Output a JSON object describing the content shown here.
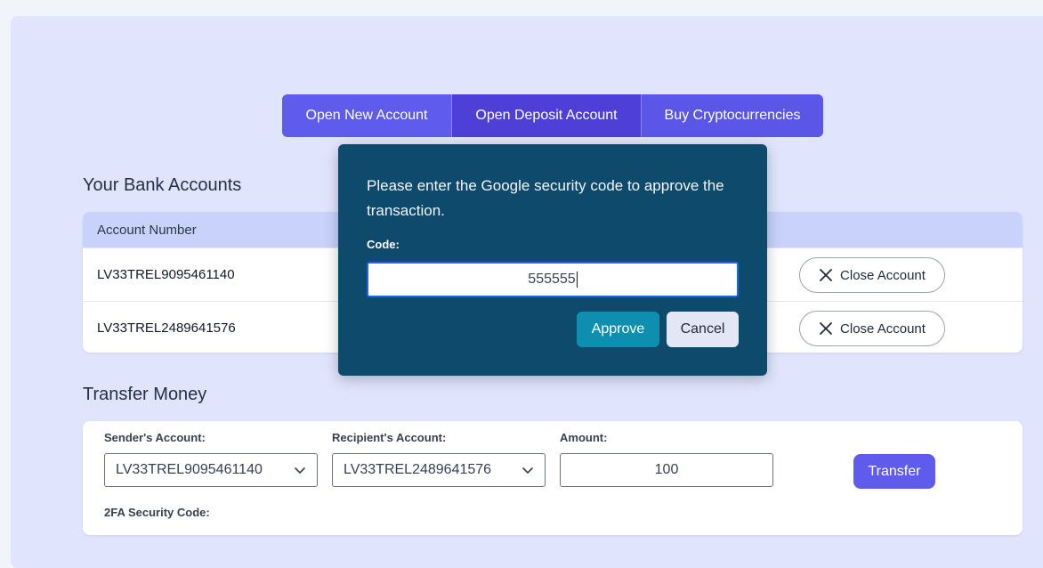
{
  "nav": {
    "open_new_account": "Open New Account",
    "open_deposit_account": "Open Deposit Account",
    "buy_crypto": "Buy Cryptocurrencies"
  },
  "accounts": {
    "title": "Your Bank Accounts",
    "column_header": "Account Number",
    "rows": [
      {
        "number": "LV33TREL9095461140",
        "action": "Close Account"
      },
      {
        "number": "LV33TREL2489641576",
        "action": "Close Account"
      }
    ]
  },
  "transfer": {
    "title": "Transfer Money",
    "sender_label": "Sender's Account:",
    "sender_value": "LV33TREL9095461140",
    "recipient_label": "Recipient's Account:",
    "recipient_value": "LV33TREL2489641576",
    "amount_label": "Amount:",
    "amount_value": "100",
    "button": "Transfer",
    "twofa_label": "2FA Security Code:"
  },
  "modal": {
    "message": "Please enter the Google security code to approve the transaction.",
    "code_label": "Code:",
    "code_value": "555555",
    "approve": "Approve",
    "cancel": "Cancel"
  },
  "colors": {
    "page_bg": "#f1f4f8",
    "panel_bg": "#e0e5fd",
    "accent": "#5f5bec",
    "modal_bg": "#0e4a6c",
    "approve_bg": "#0e8fb0",
    "table_header_bg": "#c8d2fb"
  },
  "icons": {
    "close_account": "close-x-icon",
    "select": "chevron-down-icon"
  }
}
